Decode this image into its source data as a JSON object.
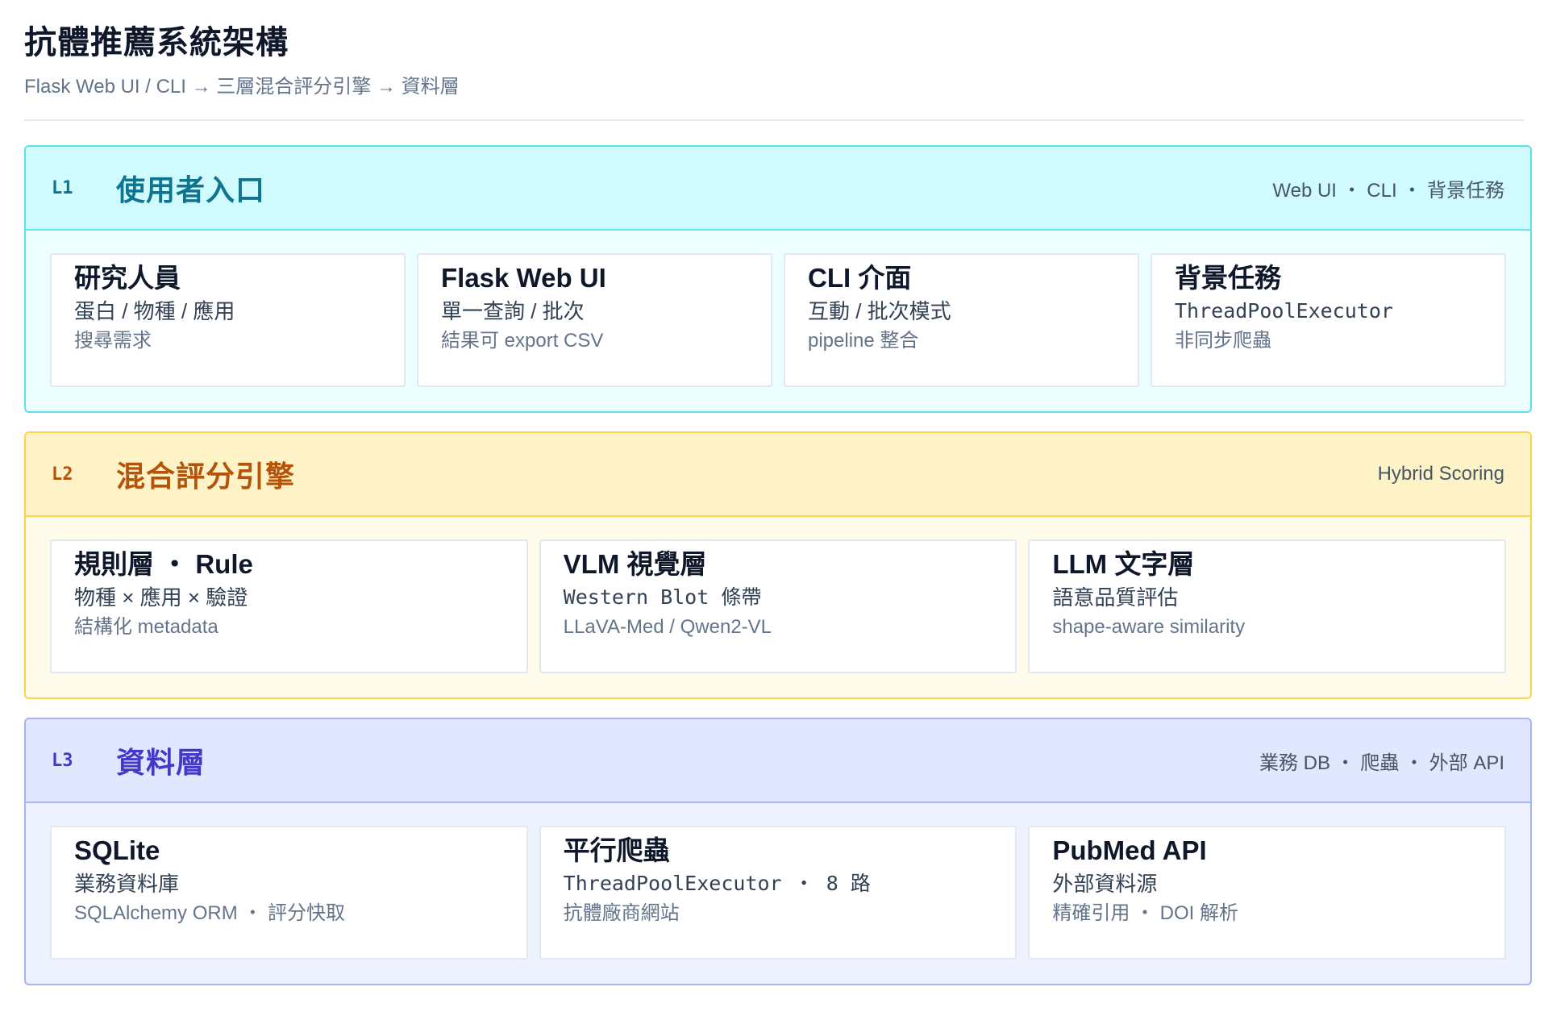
{
  "header": {
    "title": "抗體推薦系統架構",
    "subtitle": "Flask Web UI / CLI → 三層混合評分引擎 → 資料層"
  },
  "layers": [
    {
      "code": "L1",
      "name": "使用者入口",
      "note": "Web UI ・ CLI ・ 背景任務",
      "color": "#0e7490",
      "cards": [
        {
          "title": "研究人員",
          "line1": "蛋白 / 物種 / 應用",
          "line2": "搜尋需求"
        },
        {
          "title": "Flask Web UI",
          "line1": "單一查詢 / 批次",
          "line2": "結果可 export CSV"
        },
        {
          "title": "CLI 介面",
          "line1": "互動 / 批次模式",
          "line2": "pipeline 整合"
        },
        {
          "title": "背景任務",
          "line1": "ThreadPoolExecutor",
          "line2": "非同步爬蟲"
        }
      ]
    },
    {
      "code": "L2",
      "name": "混合評分引擎",
      "note": "Hybrid Scoring",
      "color": "#b45309",
      "cards": [
        {
          "title": "規則層 ・ Rule",
          "line1": "物種 × 應用 × 驗證",
          "line2": "結構化 metadata"
        },
        {
          "title": "VLM 視覺層",
          "line1": "Western Blot 條帶",
          "line2": "LLaVA-Med / Qwen2-VL"
        },
        {
          "title": "LLM 文字層",
          "line1": "語意品質評估",
          "line2": "shape-aware similarity"
        }
      ]
    },
    {
      "code": "L3",
      "name": "資料層",
      "note": "業務 DB ・ 爬蟲 ・ 外部 API",
      "color": "#4338ca",
      "cards": [
        {
          "title": "SQLite",
          "line1": "業務資料庫",
          "line2": "SQLAlchemy ORM ・ 評分快取"
        },
        {
          "title": "平行爬蟲",
          "line1": "ThreadPoolExecutor ・ 8 路",
          "line2": "抗體廠商網站"
        },
        {
          "title": "PubMed API",
          "line1": "外部資料源",
          "line2": "精確引用 ・ DOI 解析"
        }
      ]
    }
  ]
}
